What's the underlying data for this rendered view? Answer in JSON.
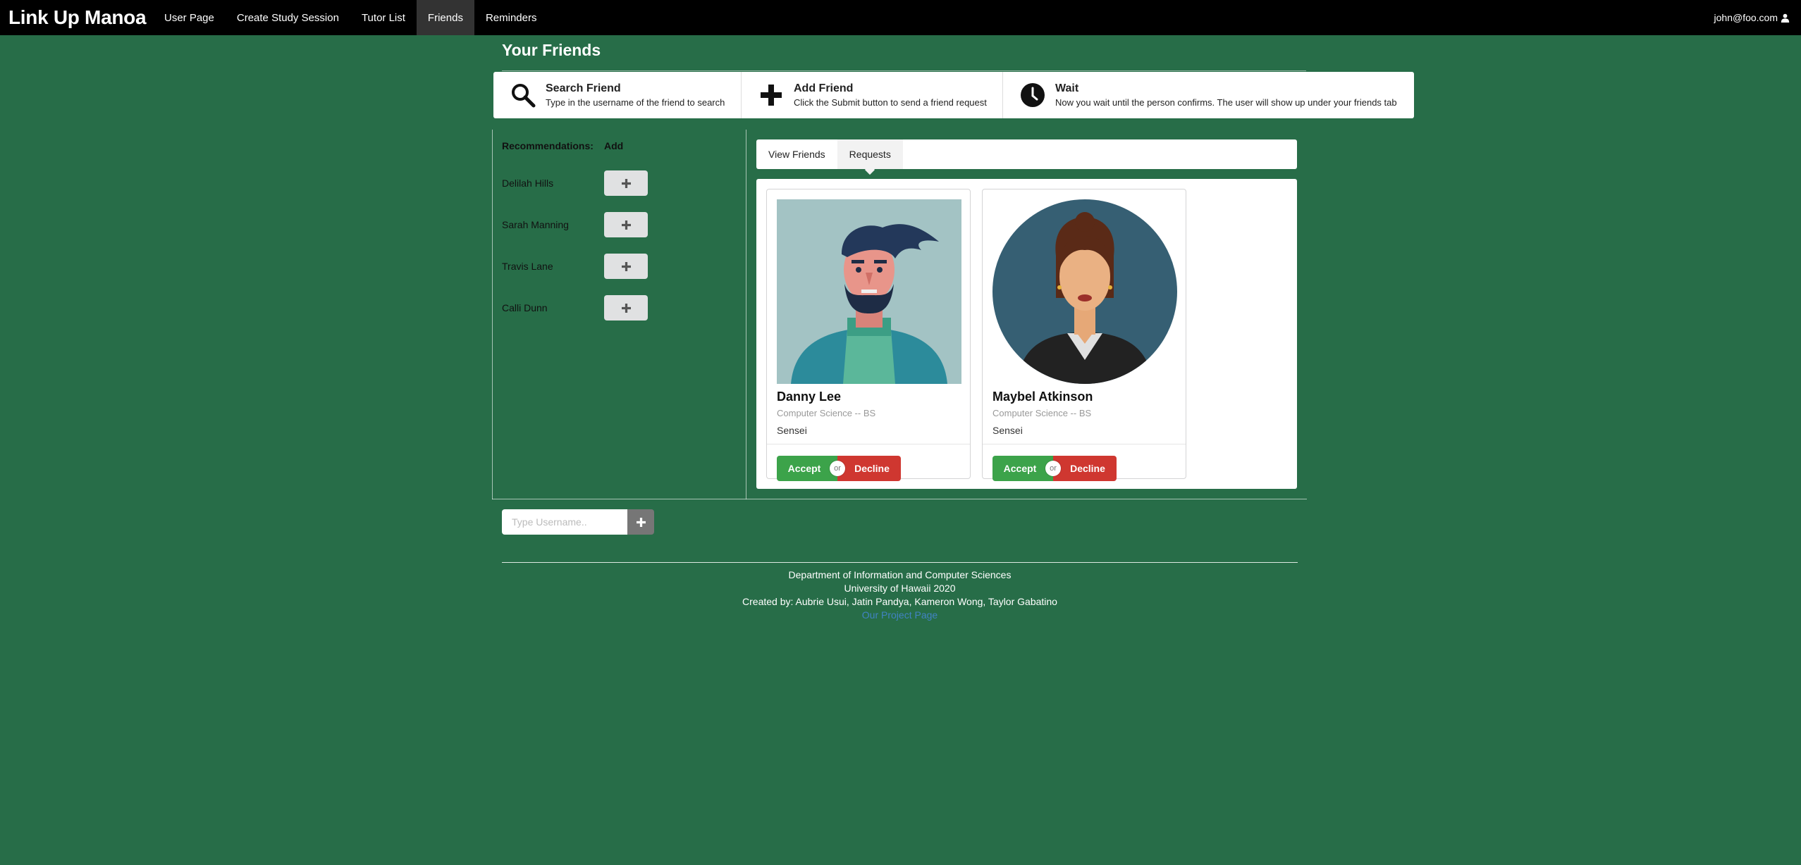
{
  "nav": {
    "brand": "Link Up Manoa",
    "items": [
      {
        "label": "User Page",
        "active": false
      },
      {
        "label": "Create Study Session",
        "active": false
      },
      {
        "label": "Tutor List",
        "active": false
      },
      {
        "label": "Friends",
        "active": true
      },
      {
        "label": "Reminders",
        "active": false
      }
    ],
    "user": "john@foo.com",
    "user_icon": "user-icon"
  },
  "page": {
    "title": "Your Friends"
  },
  "steps": [
    {
      "icon": "search-icon",
      "title": "Search Friend",
      "description": "Type in the username of the friend to search"
    },
    {
      "icon": "plus-icon",
      "title": "Add Friend",
      "description": "Click the Submit button to send a friend request"
    },
    {
      "icon": "clock-icon",
      "title": "Wait",
      "description": "Now you wait until the person confirms. The user will show up under your friends tab"
    }
  ],
  "recommendations": {
    "header_label": "Recommendations:",
    "add_header": "Add",
    "add_icon": "plus-icon",
    "people": [
      "Delilah Hills",
      "Sarah Manning",
      "Travis Lane",
      "Calli Dunn"
    ]
  },
  "tabs": [
    {
      "label": "View Friends",
      "active": false
    },
    {
      "label": "Requests",
      "active": true
    }
  ],
  "requests": [
    {
      "name": "Danny Lee",
      "meta": "Computer Science -- BS",
      "description": "Sensei",
      "accept": "Accept",
      "or": "or",
      "decline": "Decline",
      "avatar": "man-avatar"
    },
    {
      "name": "Maybel Atkinson",
      "meta": "Computer Science -- BS",
      "description": "Sensei",
      "accept": "Accept",
      "or": "or",
      "decline": "Decline",
      "avatar": "woman-avatar"
    }
  ],
  "search": {
    "placeholder": "Type Username..",
    "value": ""
  },
  "footer": {
    "line1": "Department of Information and Computer Sciences",
    "line2": "University of Hawaii 2020",
    "line3": "Created by: Aubrie Usui, Jatin Pandya, Kameron Wong, Taylor Gabatino",
    "link": "Our Project Page"
  },
  "colors": {
    "background": "#276d48",
    "nav": "#000000",
    "accept": "#3ca34a",
    "decline": "#cf3730",
    "link": "#4183c4"
  }
}
